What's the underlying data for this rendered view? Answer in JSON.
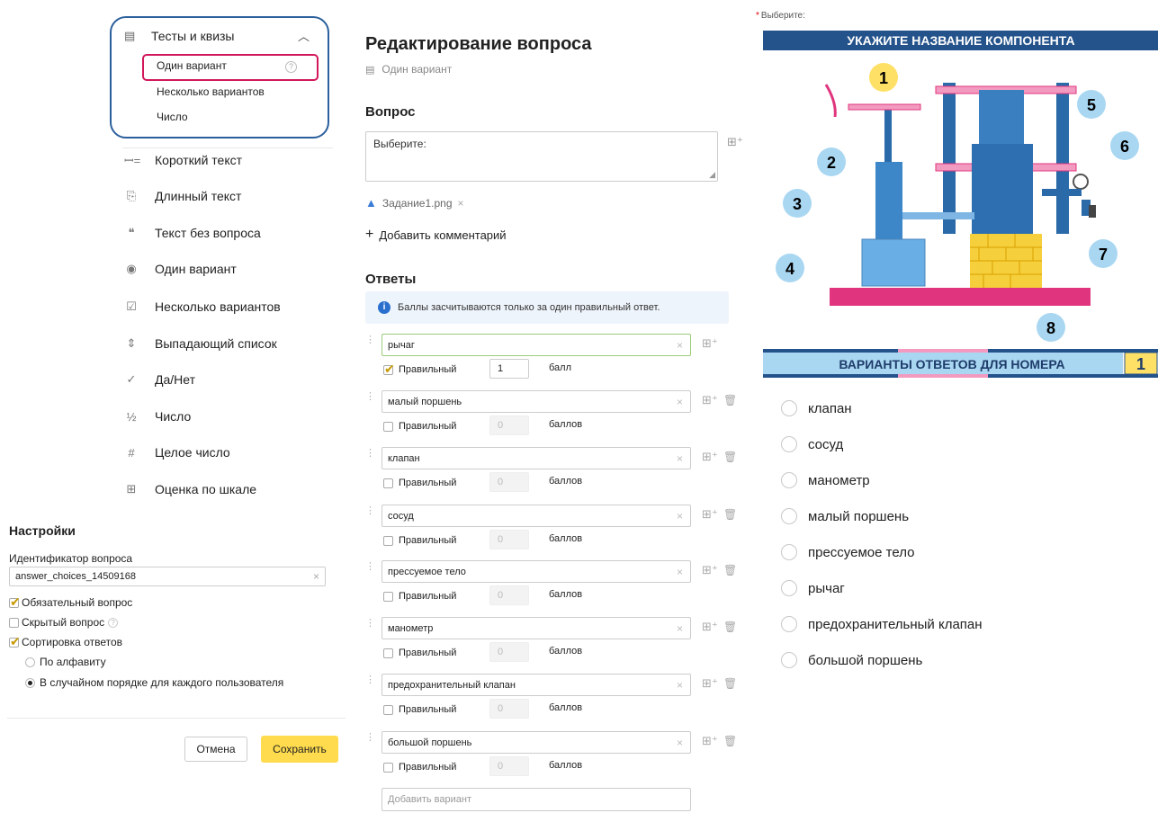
{
  "type_menu": {
    "group": {
      "label": "Тесты и квизы",
      "icon": "quiz-icon"
    },
    "sub_items": [
      {
        "label": "Один вариант",
        "selected": true
      },
      {
        "label": "Несколько вариантов"
      },
      {
        "label": "Число"
      }
    ],
    "items": [
      {
        "label": "Короткий текст",
        "icon": "short-text-icon",
        "glyph": "ꟷ="
      },
      {
        "label": "Длинный текст",
        "icon": "long-text-icon",
        "glyph": "⎘"
      },
      {
        "label": "Текст без вопроса",
        "icon": "quote-icon",
        "glyph": "❝"
      },
      {
        "label": "Один вариант",
        "icon": "radio-icon",
        "glyph": "◉"
      },
      {
        "label": "Несколько вариантов",
        "icon": "checkbox-icon",
        "glyph": "☑"
      },
      {
        "label": "Выпадающий список",
        "icon": "dropdown-icon",
        "glyph": "⇕"
      },
      {
        "label": "Да/Нет",
        "icon": "check-icon",
        "glyph": "✓"
      },
      {
        "label": "Число",
        "icon": "fraction-icon",
        "glyph": "½"
      },
      {
        "label": "Целое число",
        "icon": "hash-icon",
        "glyph": "#"
      },
      {
        "label": "Оценка по шкале",
        "icon": "grid-icon",
        "glyph": "⊞"
      }
    ]
  },
  "settings": {
    "title": "Настройки",
    "id_label": "Идентификатор вопроса",
    "id_value": "answer_choices_14509168",
    "required_label": "Обязательный вопрос",
    "required": true,
    "hidden_label": "Скрытый вопрос",
    "hidden": false,
    "sort_label": "Сортировка ответов",
    "sort": true,
    "sort_alpha_label": "По алфавиту",
    "sort_random_label": "В случайном порядке для каждого пользователя",
    "sort_mode": "random",
    "cancel_label": "Отмена",
    "save_label": "Сохранить"
  },
  "editor": {
    "title": "Редактирование вопроса",
    "subtitle": "Один вариант",
    "question_section": "Вопрос",
    "question_text": "Выберите:",
    "attachment": "Задание1.png",
    "add_comment": "Добавить комментарий",
    "answers_section": "Ответы",
    "info_text": "Баллы засчитываются только за один правильный ответ.",
    "correct_label": "Правильный",
    "answers": [
      {
        "text": "рычаг",
        "correct": true,
        "score": "1",
        "points_label": "балл"
      },
      {
        "text": "малый поршень",
        "correct": false,
        "score": "0",
        "points_label": "баллов"
      },
      {
        "text": "клапан",
        "correct": false,
        "score": "0",
        "points_label": "баллов"
      },
      {
        "text": "сосуд",
        "correct": false,
        "score": "0",
        "points_label": "баллов"
      },
      {
        "text": "прессуемое тело",
        "correct": false,
        "score": "0",
        "points_label": "баллов"
      },
      {
        "text": "манометр",
        "correct": false,
        "score": "0",
        "points_label": "баллов"
      },
      {
        "text": "предохранительный клапан",
        "correct": false,
        "score": "0",
        "points_label": "баллов"
      },
      {
        "text": "большой поршень",
        "correct": false,
        "score": "0",
        "points_label": "баллов"
      }
    ],
    "add_variant_placeholder": "Добавить вариант"
  },
  "preview": {
    "label": "Выберите:",
    "image": {
      "title": "УКАЖИТЕ НАЗВАНИЕ КОМПОНЕНТА",
      "numbers": [
        "1",
        "2",
        "3",
        "4",
        "5",
        "6",
        "7",
        "8"
      ],
      "variants_title": "ВАРИАНТЫ ОТВЕТОВ ДЛЯ НОМЕРА",
      "variants_number": "1"
    },
    "options": [
      "клапан",
      "сосуд",
      "манометр",
      "малый поршень",
      "прессуемое тело",
      "рычаг",
      "предохранительный клапан",
      "большой поршень"
    ]
  },
  "colors": {
    "accent_blue": "#2b5f9c",
    "highlight_pink": "#d2185b",
    "save_yellow": "#ffdb4d",
    "info_bg": "#eef4fb",
    "diagram_pink": "#e0357e",
    "diagram_blue": "#2a6aa8",
    "callout_blue": "#a9d7f2",
    "callout_yellow": "#ffe066"
  }
}
